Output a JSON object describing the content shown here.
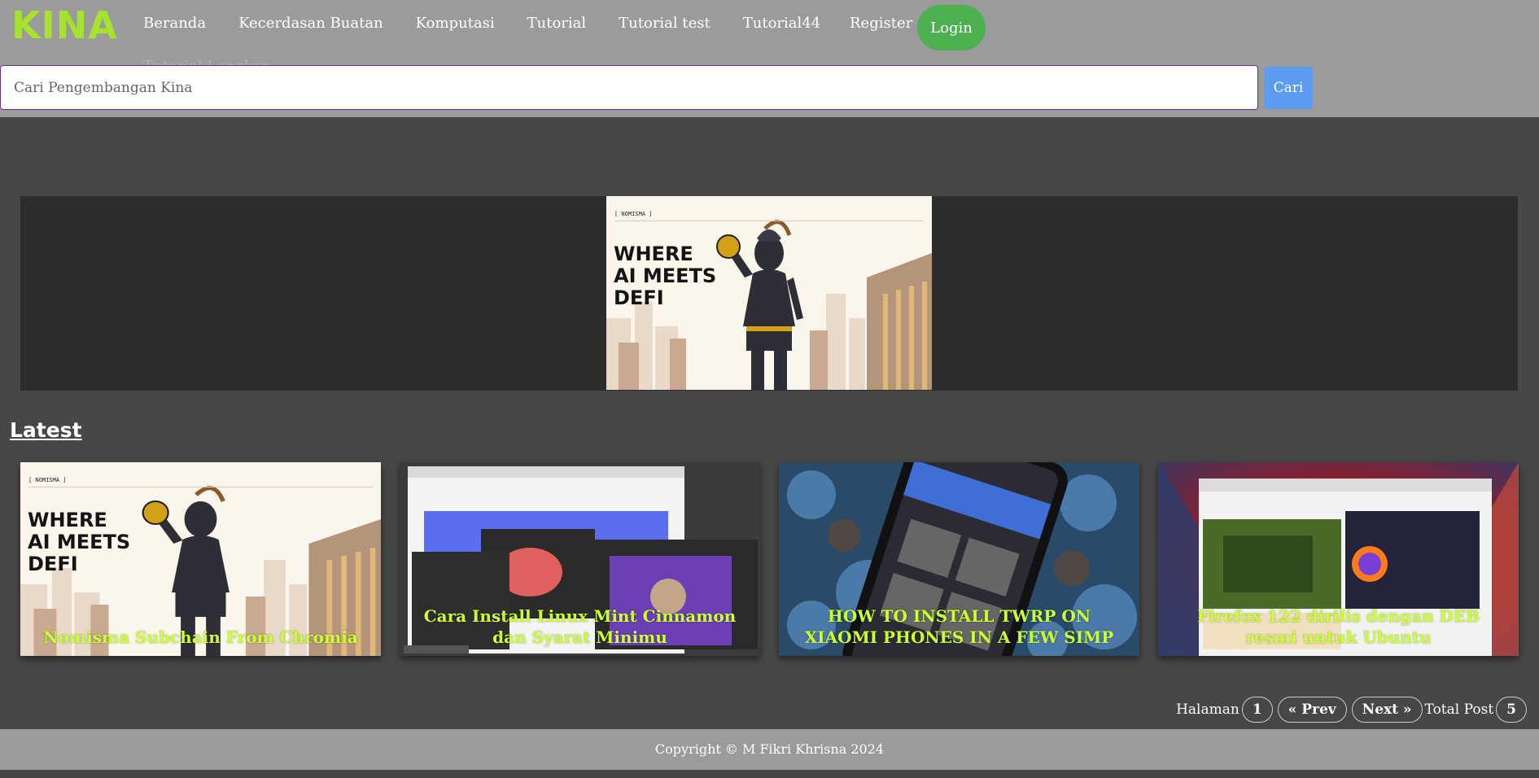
{
  "header": {
    "logo": "KINA",
    "nav": [
      "Beranda",
      "Kecerdasan Buatan",
      "Komputasi",
      "Tutorial",
      "Tutorial test",
      "Tutorial44"
    ],
    "nav_overflow": "Tutorial Lengkap",
    "register": "Register",
    "login": "Login"
  },
  "search": {
    "placeholder": "Cari Pengembangan Kina",
    "button": "Cari"
  },
  "banner": {
    "brand": "[ NOMISMA ]",
    "tagline": "WHERE\nAI MEETS\nDEFI"
  },
  "latest": {
    "title": "Latest",
    "posts": [
      {
        "title": "Nomisma Subchain From Chromia"
      },
      {
        "title": "Cara Install Linux Mint Cinnamon dan Syarat Minimu"
      },
      {
        "title": "HOW TO INSTALL TWRP ON XIAOMI PHONES IN A FEW SIMP"
      },
      {
        "title": "Firefox 122 dirilis dengan DEB resmi untuk Ubuntu"
      }
    ]
  },
  "pagination": {
    "label": "Halaman",
    "page": "1",
    "prev": "« Prev",
    "next": "Next »",
    "total_label": "Total Post",
    "total": "5"
  },
  "footer": {
    "copyright": "Copyright © M Fikri Khrisna 2024"
  },
  "colors": {
    "header_bg": "#9b9b9b",
    "logo": "#a6e22e",
    "login": "#4caf50",
    "search_button": "#5b9cf0",
    "caption": "#ccff33"
  }
}
